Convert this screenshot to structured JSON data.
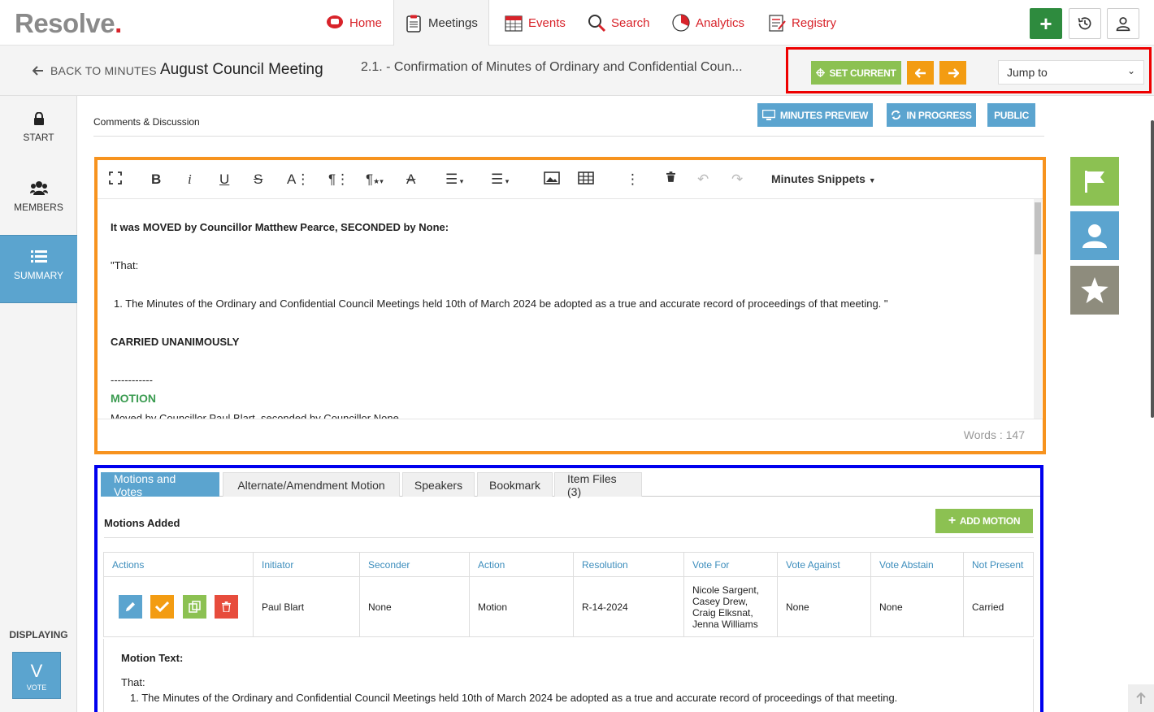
{
  "app": {
    "logo_text": "Resolve",
    "logo_dot": "."
  },
  "nav": {
    "tabs": [
      {
        "label": "Home",
        "icon": "home-icon"
      },
      {
        "label": "Meetings",
        "icon": "clipboard-icon",
        "active": true
      },
      {
        "label": "Events",
        "icon": "calendar-icon"
      },
      {
        "label": "Search",
        "icon": "search-icon"
      },
      {
        "label": "Analytics",
        "icon": "pie-chart-icon"
      },
      {
        "label": "Registry",
        "icon": "register-icon"
      }
    ],
    "add_symbol": "+",
    "accent": "#d8232a"
  },
  "subbar": {
    "back_label": "BACK TO MINUTES",
    "meeting_title": "August Council Meeting",
    "item_title": "2.1. - Confirmation of Minutes of Ordinary and Confidential Coun...",
    "set_current_label": "SET CURRENT",
    "jump_to_label": "Jump to"
  },
  "sidebar": {
    "items": [
      {
        "label": "START",
        "icon": "lock-icon"
      },
      {
        "label": "MEMBERS",
        "icon": "users-icon"
      },
      {
        "label": "SUMMARY",
        "icon": "list-icon",
        "active": true
      }
    ],
    "displaying_label": "DISPLAYING",
    "vote_letter": "V",
    "vote_label": "VOTE"
  },
  "main": {
    "comments_label": "Comments & Discussion",
    "status_buttons": {
      "minutes_preview": "MINUTES PREVIEW",
      "in_progress": "IN PROGRESS",
      "public": "PUBLIC"
    }
  },
  "editor": {
    "snippets_label": "Minutes Snippets",
    "lines": {
      "moved": "It was MOVED by Councillor Matthew Pearce, SECONDED by None:",
      "that": "\"That:",
      "item1": "1. The Minutes of the Ordinary and Confidential Council Meetings held 10th of March 2024  be adopted as a true and accurate record of proceedings of that meeting. \"",
      "carried": "CARRIED UNANIMOUSLY",
      "dashes": "------------",
      "motion_heading": "MOTION",
      "moved2": "Moved by Councillor Paul Blart, seconded by Councillor None"
    },
    "words_label": "Words : 147"
  },
  "tabs_panel": {
    "tabs": [
      "Motions and Votes",
      "Alternate/Amendment Motion",
      "Speakers",
      "Bookmark",
      "Item Files (3)"
    ],
    "motions_added_label": "Motions Added",
    "add_motion_label": "ADD MOTION",
    "table": {
      "headers": [
        "Actions",
        "Initiator",
        "Seconder",
        "Action",
        "Resolution",
        "Vote For",
        "Vote Against",
        "Vote Abstain",
        "Not Present"
      ],
      "row": {
        "initiator": "Paul Blart",
        "seconder": "None",
        "action": "Motion",
        "resolution": "R-14-2024",
        "vote_for": [
          "Nicole Sargent,",
          "Casey Drew,",
          "Craig Elksnat,",
          "Jenna Williams"
        ],
        "vote_against": "None",
        "vote_abstain": "None",
        "not_present": "Carried"
      }
    },
    "motion_text": {
      "label": "Motion Text:",
      "that": "That:",
      "item1": "1.  The Minutes of the Ordinary and Confidential Council Meetings held 10th of March 2024  be adopted as a true and accurate record of proceedings of that meeting."
    }
  },
  "colors": {
    "blue": "#5ba4cf",
    "green": "#8cc152",
    "orange": "#f39c12",
    "red": "#e74c3c",
    "dark_green": "#2e8b3e",
    "gray_star": "#8e8c7d"
  }
}
